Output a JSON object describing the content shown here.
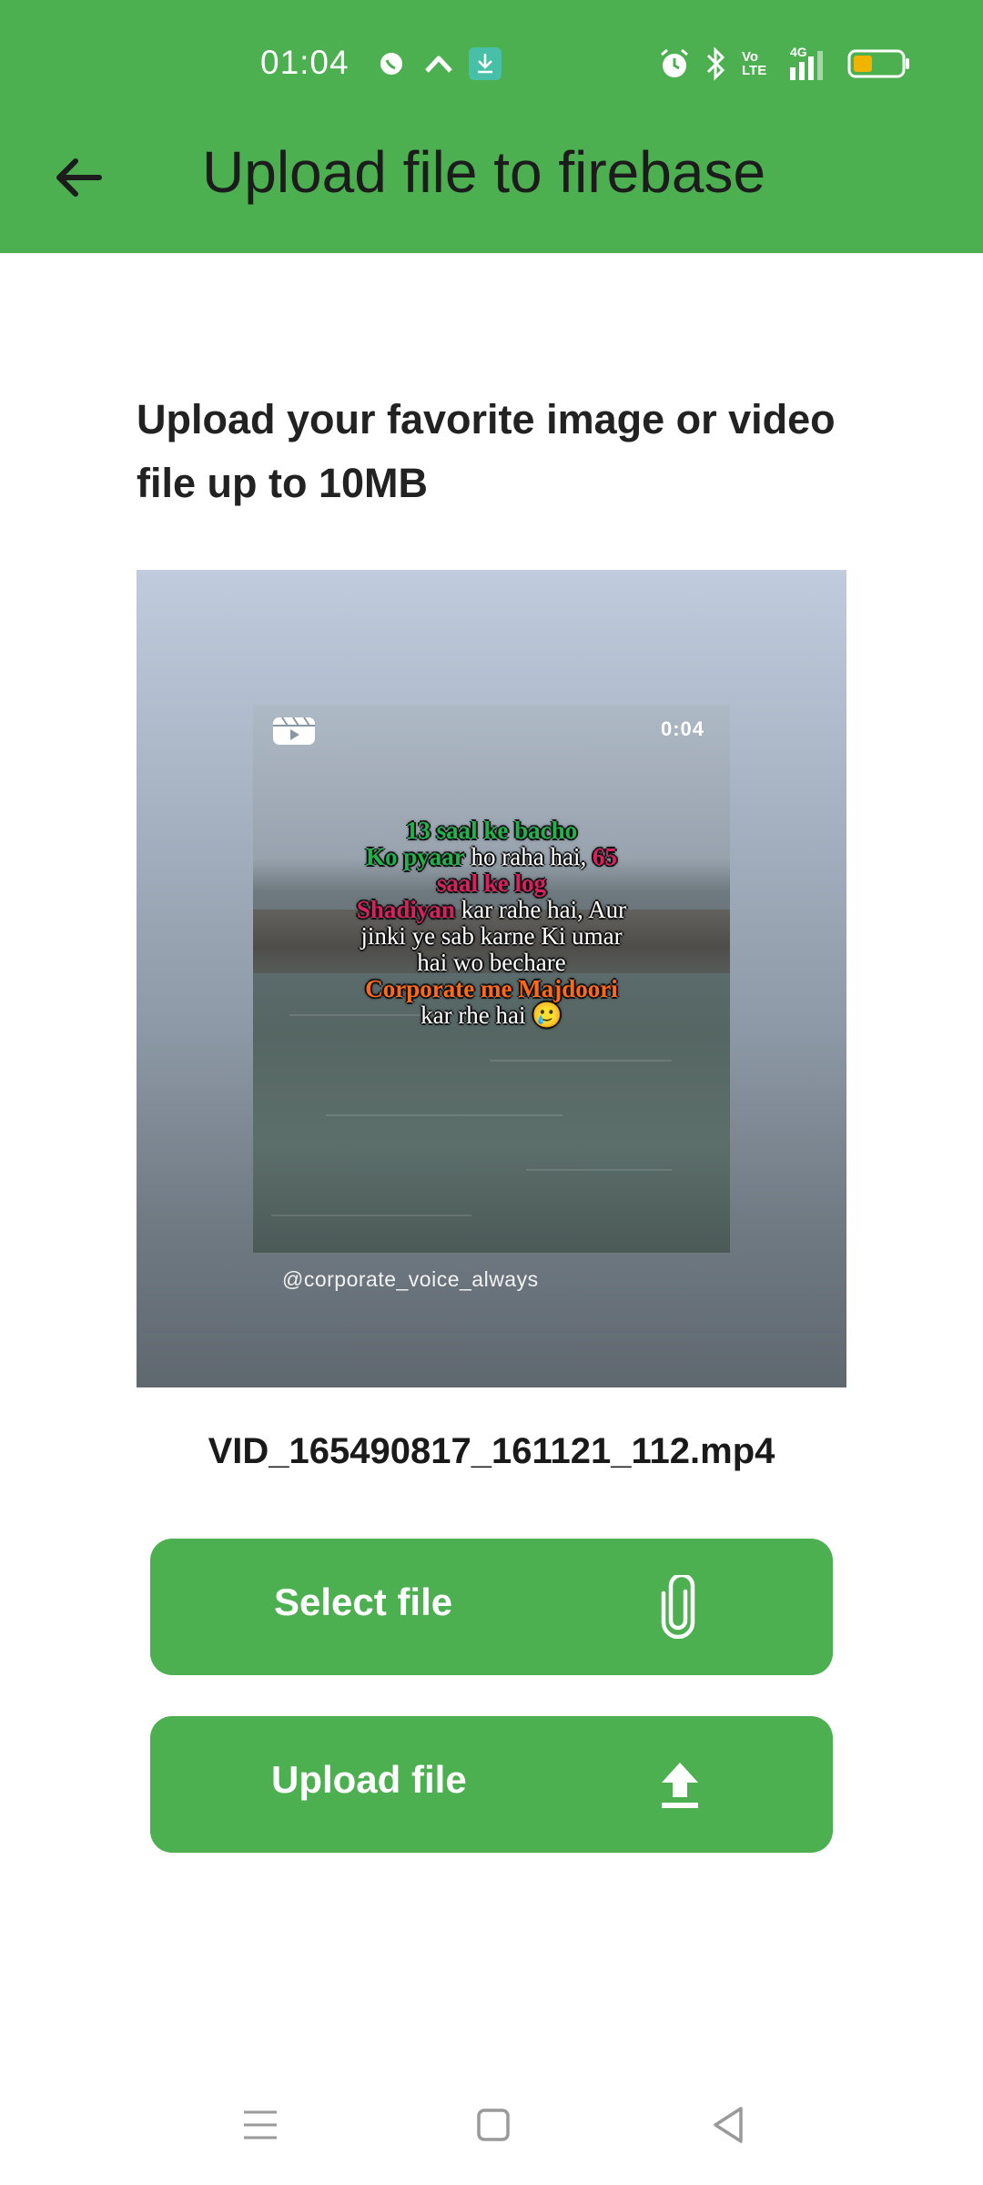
{
  "status_bar": {
    "time": "01:04",
    "network": "4G",
    "icons": [
      "whatsapp-icon",
      "chevron-up-icon",
      "download-icon",
      "alarm-icon",
      "bluetooth-icon",
      "volte-icon",
      "signal-icon",
      "battery-icon"
    ],
    "volte_label": "Vo LTE",
    "battery_color": "#f0b400"
  },
  "app_bar": {
    "title": "Upload file to firebase",
    "back_icon": "arrow-left-icon",
    "color": "#4caf50"
  },
  "main": {
    "heading": "Upload your favorite image or video file up to 10MB",
    "preview": {
      "duration": "0:04",
      "caption": [
        [
          {
            "t": "13 saal ke bacho",
            "c": "g"
          }
        ],
        [
          {
            "t": "Ko pyaar",
            "c": "g"
          },
          {
            "t": " ho raha hai, ",
            "c": ""
          },
          {
            "t": "65",
            "c": "r"
          }
        ],
        [
          {
            "t": "saal ke log",
            "c": "r"
          }
        ],
        [
          {
            "t": "Shadiyan",
            "c": "r"
          },
          {
            "t": " kar rahe hai, Aur",
            "c": ""
          }
        ],
        [
          {
            "t": "jinki ye sab karne Ki umar",
            "c": ""
          }
        ],
        [
          {
            "t": "hai wo bechare",
            "c": ""
          }
        ],
        [
          {
            "t": "Corporate me Majdoori",
            "c": "o"
          }
        ],
        [
          {
            "t": "kar rhe hai 🥲",
            "c": ""
          }
        ]
      ],
      "watermark": "@corporate_voice_always"
    },
    "file_name": "VID_165490817_161121_112.mp4",
    "select_button": {
      "label": "Select file",
      "icon": "paperclip-icon"
    },
    "upload_button": {
      "label": "Upload file",
      "icon": "upload-icon"
    }
  },
  "nav_bar": {
    "icons": [
      "menu-icon",
      "home-icon",
      "back-icon"
    ]
  }
}
